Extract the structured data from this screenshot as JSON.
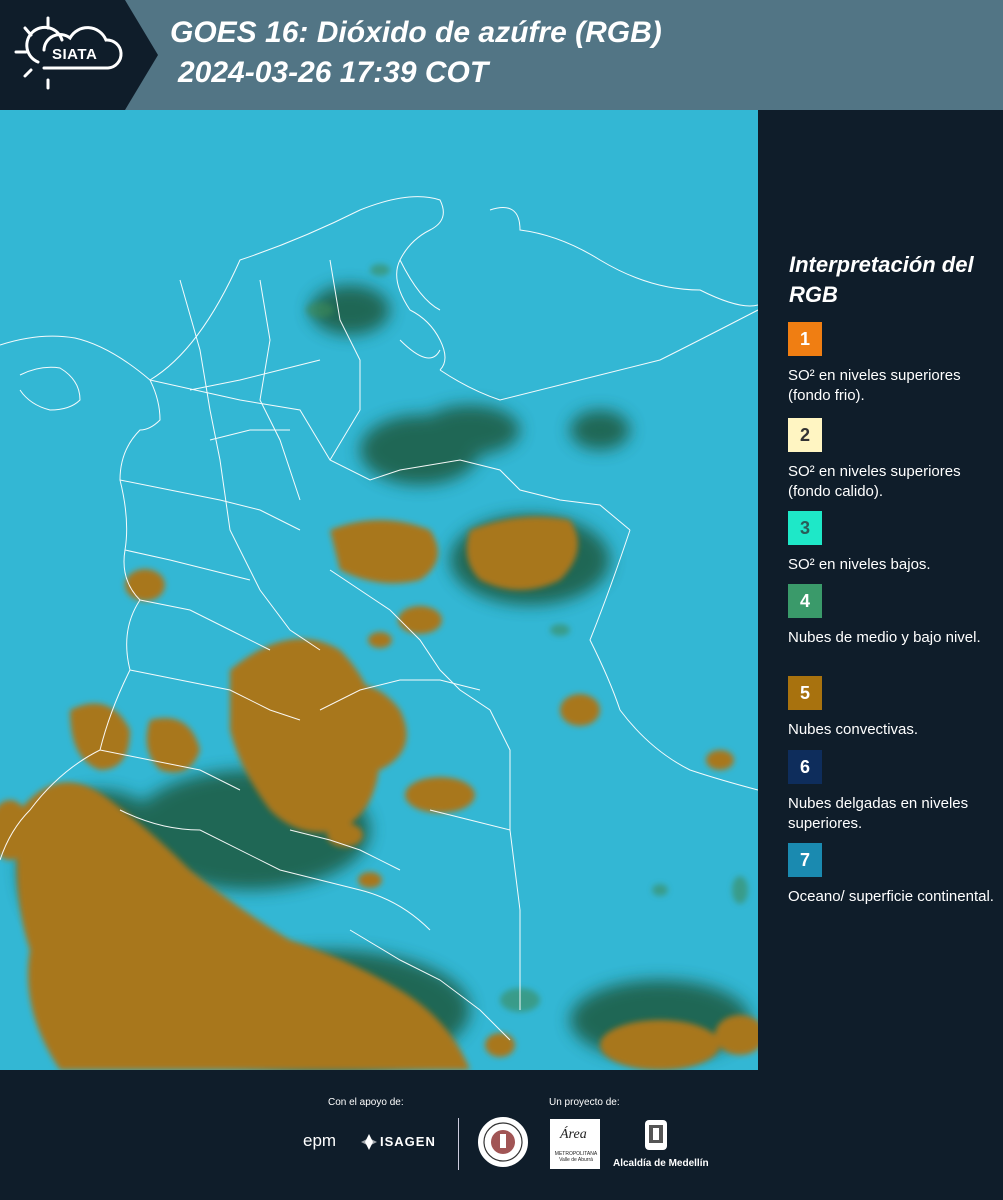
{
  "header": {
    "logo_text": "SIATA",
    "title_line1": "GOES 16: Dióxido de azúfre (RGB)",
    "title_line2": "2024-03-26 17:39 COT"
  },
  "legend": {
    "title": "Interpretación del RGB",
    "items": [
      {
        "number": "1",
        "color": "#f07e12",
        "text": "SO² en niveles superiores (fondo frio)."
      },
      {
        "number": "2",
        "color": "#fff5c2",
        "text": "SO² en niveles superiores (fondo calido)."
      },
      {
        "number": "3",
        "color": "#1ee8c8",
        "text": "SO² en niveles bajos."
      },
      {
        "number": "4",
        "color": "#3a9a6a",
        "text": "Nubes de medio y bajo nivel."
      },
      {
        "number": "5",
        "color": "#a8720e",
        "text": "Nubes convectivas."
      },
      {
        "number": "6",
        "color": "#0e2d5c",
        "text": "Nubes delgadas en niveles superiores."
      },
      {
        "number": "7",
        "color": "#1a8ab0",
        "text": "Oceano/ superficie continental."
      }
    ]
  },
  "footer": {
    "support_label": "Con el apoyo de:",
    "project_label": "Un proyecto de:",
    "sponsor_epm": "epm",
    "sponsor_isagen": "ISAGEN",
    "area_metro": "Área",
    "area_metro_sub": "METROPOLITANA Valle de Aburrá",
    "alcaldia": "Alcaldía de Medellín"
  }
}
